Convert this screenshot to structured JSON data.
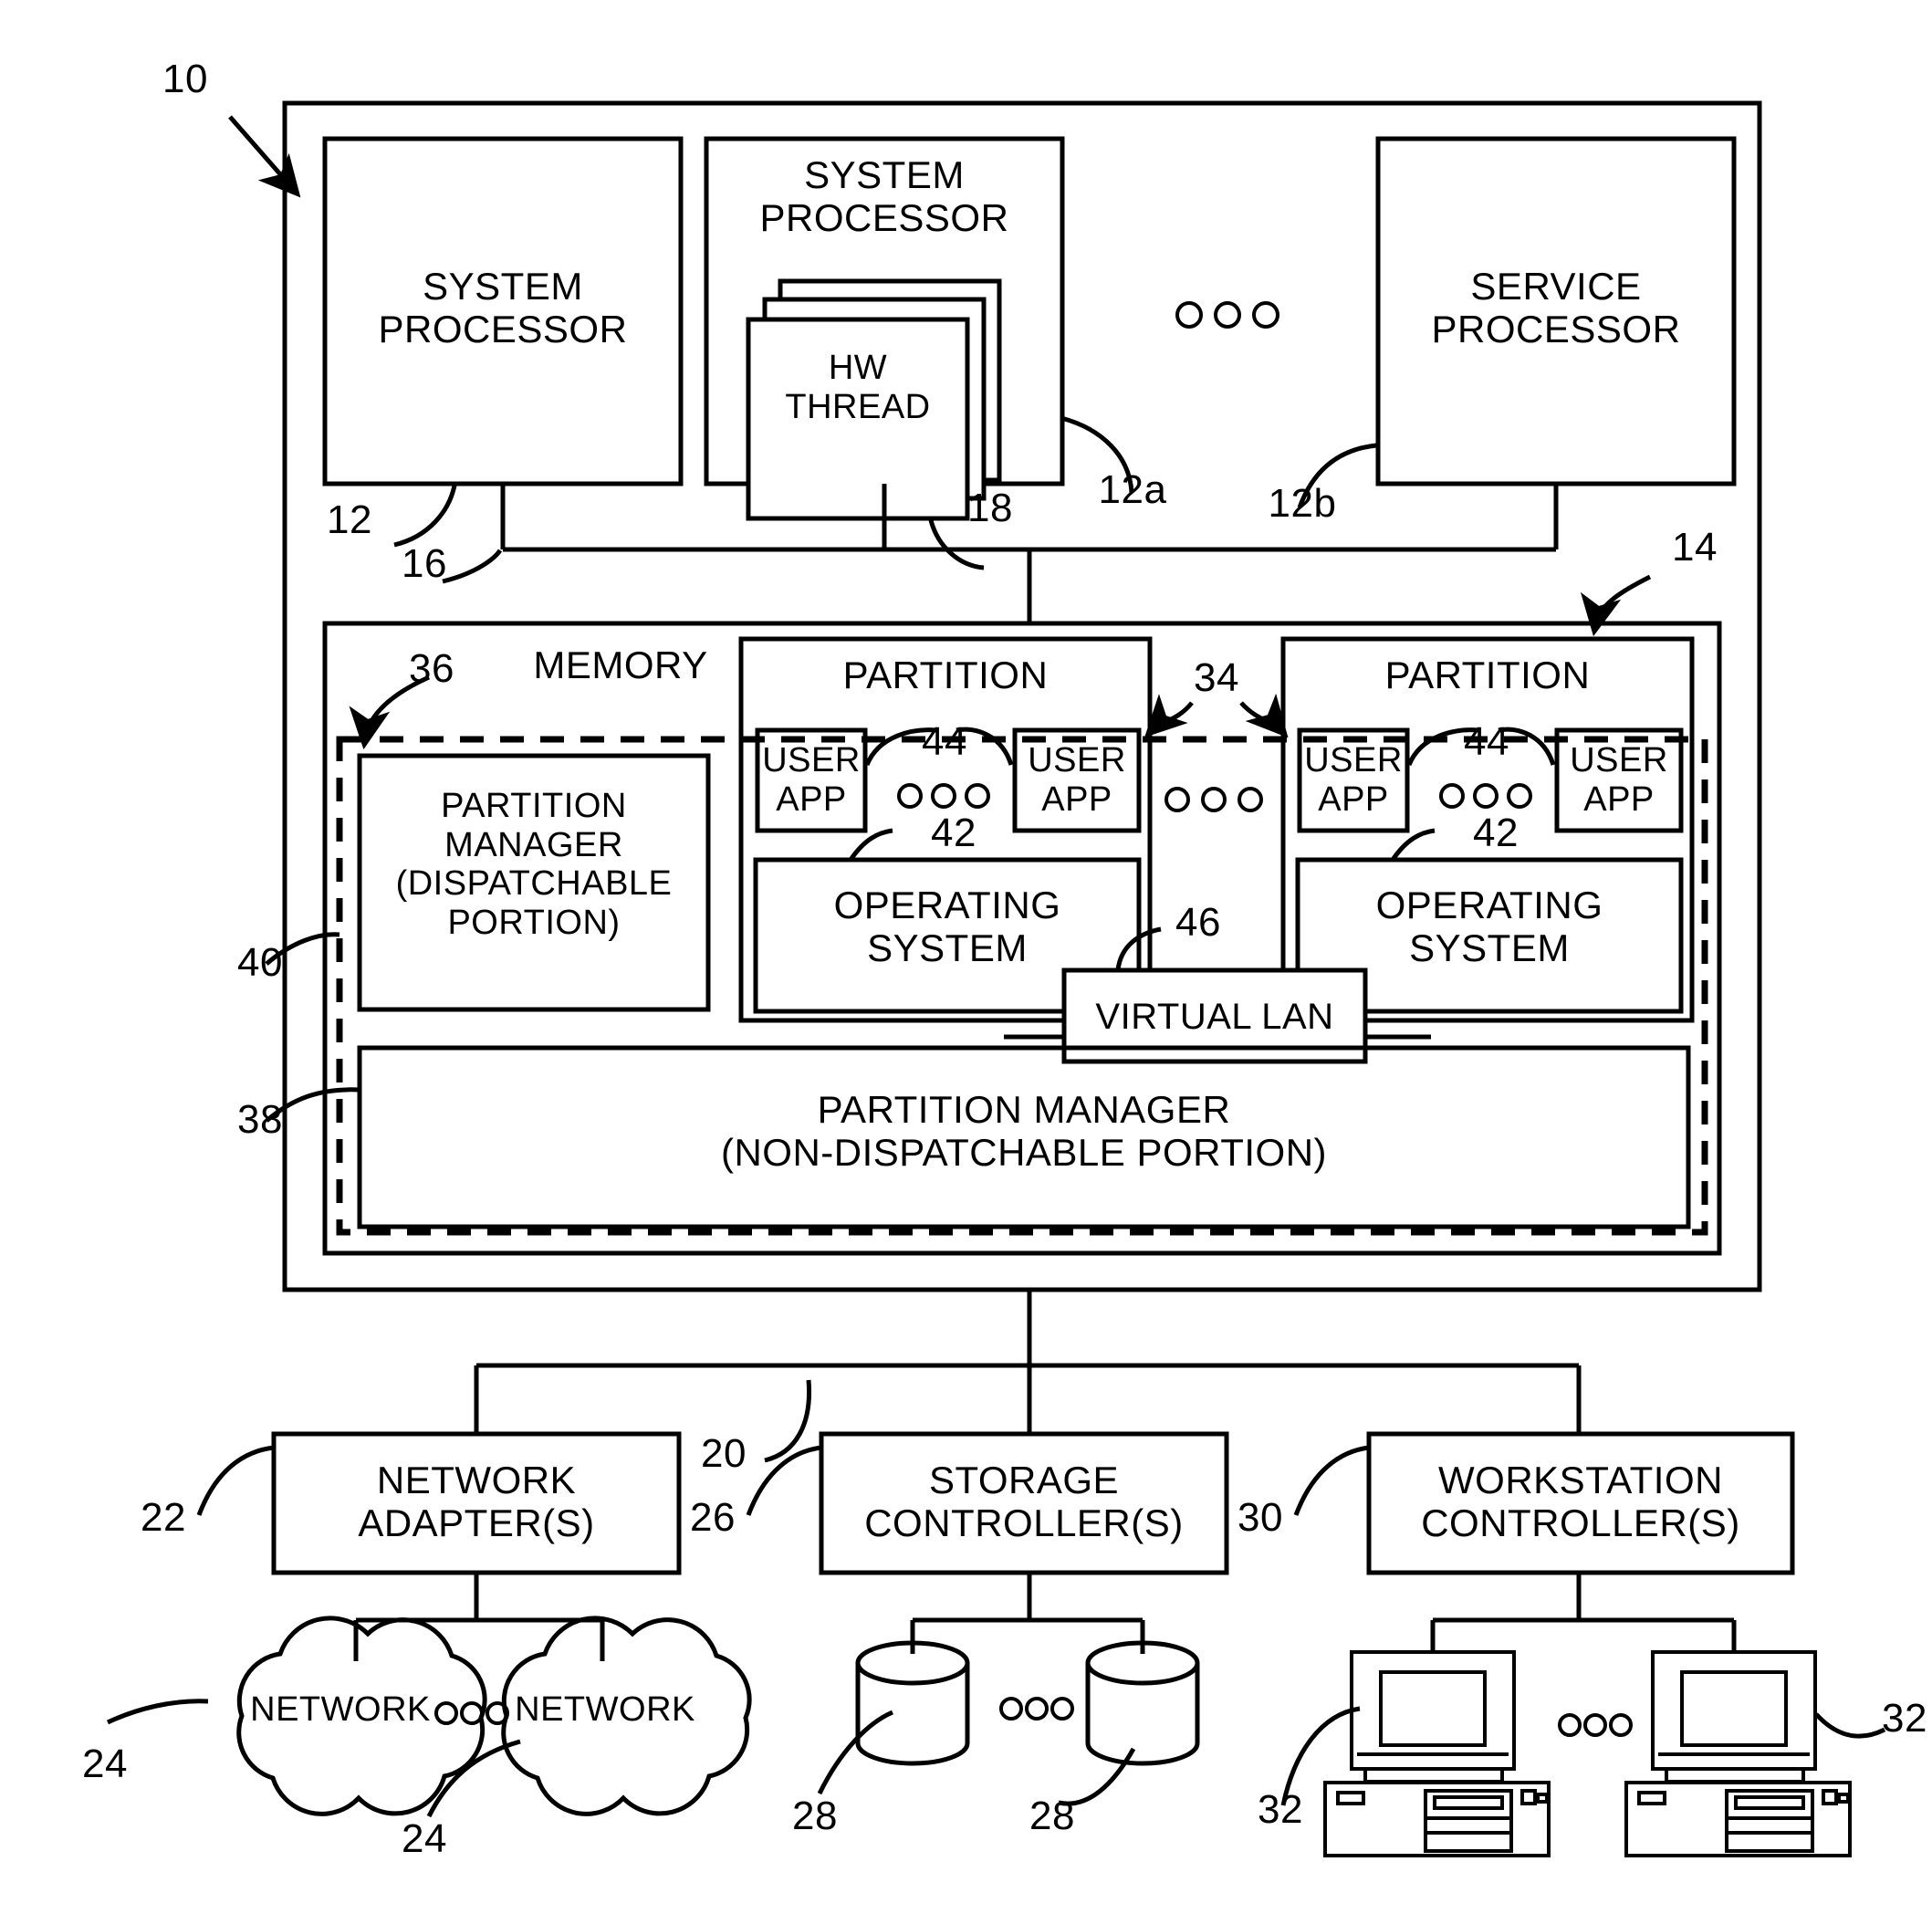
{
  "figure": {
    "type": "patent-block-diagram",
    "system_reference": "10"
  },
  "blocks": {
    "system_processor_1": "SYSTEM\nPROCESSOR",
    "system_processor_2": "SYSTEM\nPROCESSOR",
    "hw_thread": "HW\nTHREAD",
    "service_processor": "SERVICE\nPROCESSOR",
    "memory_label": "MEMORY",
    "partition_manager_dispatchable": "PARTITION\nMANAGER\n(DISPATCHABLE\nPORTION)",
    "partition_manager_nondispatchable": "PARTITION MANAGER\n(NON-DISPATCHABLE PORTION)",
    "partition_left": "PARTITION",
    "partition_right": "PARTITION",
    "user_app": "USER\nAPP",
    "operating_system": "OPERATING\nSYSTEM",
    "virtual_lan": "VIRTUAL LAN",
    "network_adapters": "NETWORK\nADAPTER(S)",
    "storage_controllers": "STORAGE\nCONTROLLER(S)",
    "workstation_controllers": "WORKSTATION\nCONTROLLER(S)",
    "network_cloud": "NETWORK"
  },
  "reference_numerals": {
    "system": "10",
    "system_processor": "12",
    "processor_group_a": "12a",
    "processor_group_b": "12b",
    "memory_unit": "14",
    "bus": "16",
    "hw_thread": "18",
    "io_bus": "20",
    "network_adapter": "22",
    "network": "24",
    "storage_controller": "26",
    "storage_device": "28",
    "workstation_controller": "30",
    "workstation": "32",
    "partition": "34",
    "memory_region": "36",
    "partition_manager_nondispatchable": "38",
    "partition_manager_boundary": "40",
    "operating_system": "42",
    "user_app": "44",
    "virtual_lan": "46"
  },
  "ellipsis": {
    "glyph": "○ ○ ○"
  },
  "colors": {
    "ink": "#000000",
    "paper": "#ffffff"
  }
}
